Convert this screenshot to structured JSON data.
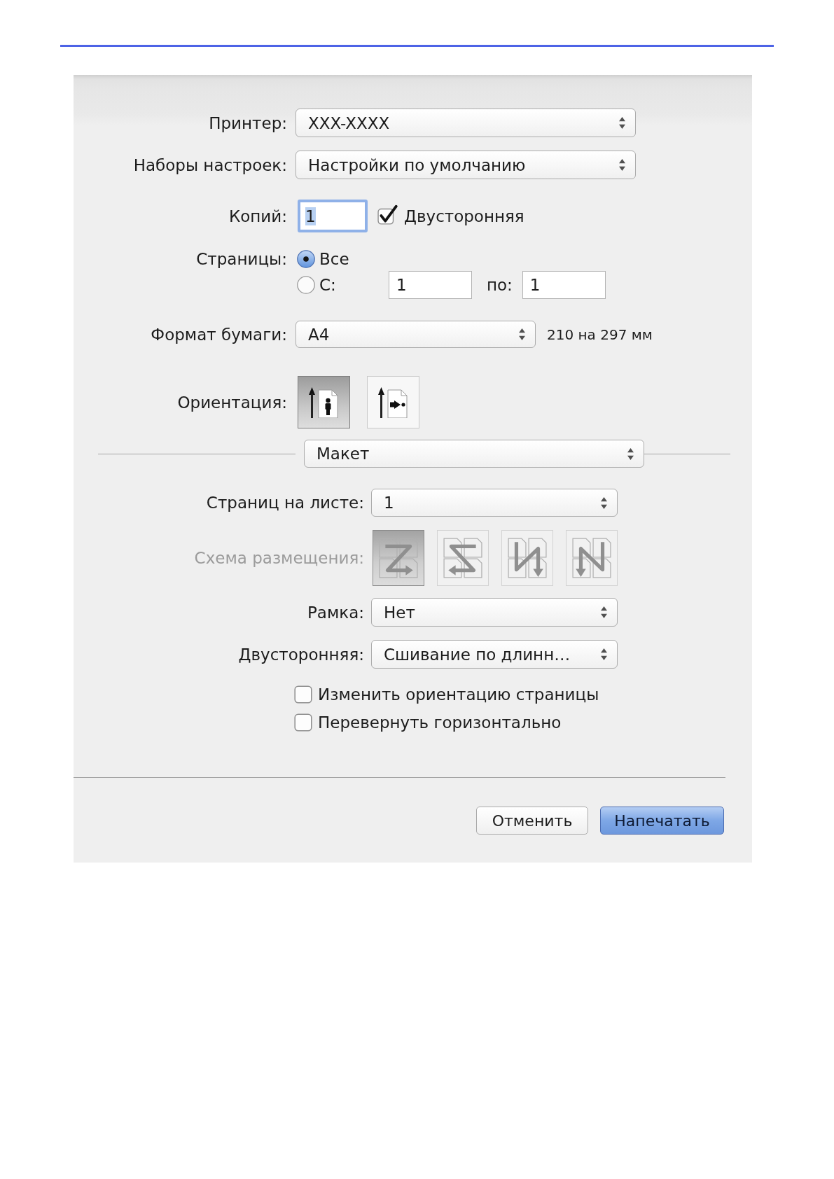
{
  "dialog": {
    "printer": {
      "label": "Принтер:",
      "value": "XXX-XXXX"
    },
    "presets": {
      "label": "Наборы настроек:",
      "value": "Настройки по умолчанию"
    },
    "copies": {
      "label": "Копий:",
      "value": "1",
      "focused": true
    },
    "duplex": {
      "label": "Двусторонняя",
      "checked": true
    },
    "pages": {
      "label": "Страницы:",
      "options": [
        {
          "label": "Все",
          "selected": true
        },
        {
          "label": "С:",
          "selected": false,
          "from": "1",
          "to_label": "по:",
          "to": "1"
        }
      ]
    },
    "paper_size": {
      "label": "Формат бумаги:",
      "value": "A4",
      "dimensions": "210 на 297 мм"
    },
    "orientation": {
      "label": "Ориентация:",
      "options": [
        {
          "kind": "portrait",
          "selected": true
        },
        {
          "kind": "landscape",
          "selected": false
        }
      ]
    },
    "panel_select": {
      "value": "Макет"
    },
    "pages_per_sheet": {
      "label": "Страниц на листе:",
      "value": "1"
    },
    "layout_direction": {
      "label": "Схема размещения:",
      "disabled": true,
      "options": [
        {
          "kind": "z",
          "selected": true
        },
        {
          "kind": "reverse-z",
          "selected": false
        },
        {
          "kind": "n",
          "selected": false
        },
        {
          "kind": "reverse-n",
          "selected": false
        }
      ]
    },
    "border": {
      "label": "Рамка:",
      "value": "Нет"
    },
    "two_sided": {
      "label": "Двусторонняя:",
      "value": "Сшивание по длинн…"
    },
    "options": [
      {
        "label": "Изменить ориентацию страницы",
        "checked": false
      },
      {
        "label": "Перевернуть горизонтально",
        "checked": false
      }
    ],
    "buttons": [
      {
        "kind": "cancel",
        "label": "Отменить"
      },
      {
        "kind": "confirm",
        "label": "Напечатать"
      }
    ]
  }
}
